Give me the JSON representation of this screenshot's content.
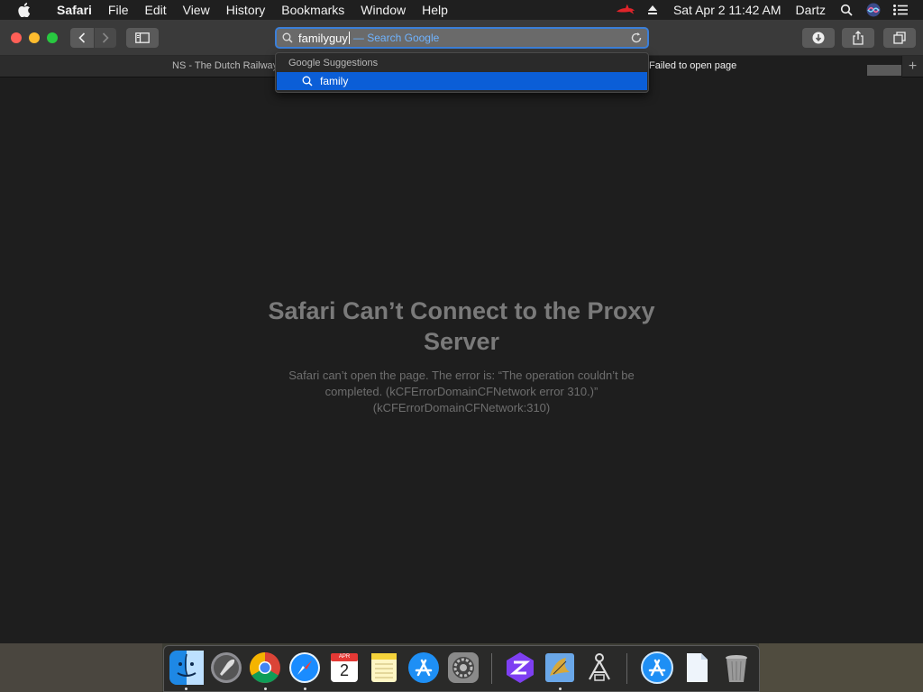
{
  "menubar": {
    "app_name": "Safari",
    "items": [
      "File",
      "Edit",
      "View",
      "History",
      "Bookmarks",
      "Window",
      "Help"
    ],
    "datetime": "Sat Apr 2  11:42 AM",
    "user": "Dartz"
  },
  "toolbar": {
    "typed_text": "familyguy",
    "search_hint": "— Search Google"
  },
  "tabs": {
    "tab1_label": "NS - The Dutch Railways",
    "tab2_label": "Failed to open page"
  },
  "suggestions": {
    "header": "Google Suggestions",
    "items": [
      "family"
    ]
  },
  "error": {
    "title": "Safari Can’t Connect to the Proxy Server",
    "body": "Safari can’t open the page. The error is: “The operation couldn’t be completed. (kCFErrorDomainCFNetwork error 310.)” (kCFErrorDomainCFNetwork:310)"
  },
  "dock": {
    "calendar_month": "APR",
    "calendar_day": "2",
    "apps": [
      "finder-icon",
      "launchpad-icon",
      "chrome-icon",
      "safari-icon",
      "calendar-icon",
      "notes-icon",
      "app-store-icon",
      "system-preferences-icon",
      "zed-icon",
      "mail-icon",
      "ssh-tool-icon",
      "app-store-download-icon",
      "document-icon",
      "trash-icon"
    ]
  },
  "colors": {
    "accent": "#0b5ed7",
    "focus_ring": "#3b7fd8",
    "close": "#ff5f57",
    "minimize": "#febc2e",
    "maximize": "#28c840"
  }
}
